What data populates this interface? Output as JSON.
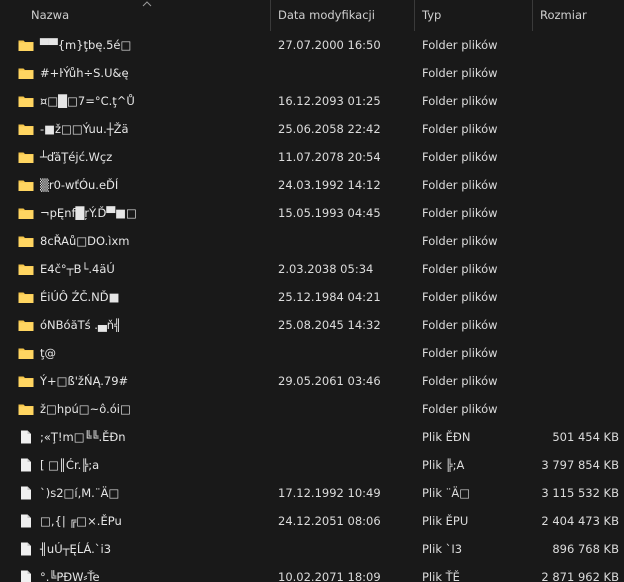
{
  "header": {
    "name": "Nazwa",
    "date": "Data modyfikacji",
    "type": "Typ",
    "size": "Rozmiar"
  },
  "colors": {
    "background": "#191919",
    "folder": "#f4c54a",
    "file": "#f0f0f0"
  },
  "rows": [
    {
      "icon": "folder-icon",
      "name": "▀▀{m}ţbę.5é□",
      "date": "27.07.2000 16:50",
      "type": "Folder plików",
      "size": ""
    },
    {
      "icon": "folder-icon",
      "name": "#+ŀÝůh÷S.U&ę",
      "date": "",
      "type": "Folder plików",
      "size": ""
    },
    {
      "icon": "folder-icon",
      "name": "¤□█□7=°C.ţ^Ů",
      "date": "16.12.2093 01:25",
      "type": "Folder plików",
      "size": ""
    },
    {
      "icon": "folder-icon",
      "name": "-■ž□□Ýuu.┼Žä",
      "date": "25.06.2058 22:42",
      "type": "Folder plików",
      "size": ""
    },
    {
      "icon": "folder-icon",
      "name": "┴ďăŢéjć.Wçz",
      "date": "11.07.2078 20:54",
      "type": "Folder plików",
      "size": ""
    },
    {
      "icon": "folder-icon",
      "name": "▒r0-wťÓu.eĎÍ",
      "date": "24.03.1992 14:12",
      "type": "Folder plików",
      "size": ""
    },
    {
      "icon": "folder-icon",
      "name": "¬pĘnf█ŗÝ.Ď▀■□",
      "date": "15.05.1993 04:45",
      "type": "Folder plików",
      "size": ""
    },
    {
      "icon": "folder-icon",
      "name": "8cŘAů□DO.ìxm",
      "date": "",
      "type": "Folder plików",
      "size": ""
    },
    {
      "icon": "folder-icon",
      "name": "E4č°┬B└.4äÚ",
      "date": "2.03.2038 05:34",
      "type": "Folder plików",
      "size": ""
    },
    {
      "icon": "folder-icon",
      "name": "ÉiÚÔ ŹČ.NĎ■",
      "date": "25.12.1984 04:21",
      "type": "Folder plików",
      "size": ""
    },
    {
      "icon": "folder-icon",
      "name": "óNBóăTś .▄ň╣",
      "date": "25.08.2045 14:32",
      "type": "Folder plików",
      "size": ""
    },
    {
      "icon": "folder-icon",
      "name": "ţ@",
      "date": "",
      "type": "Folder plików",
      "size": ""
    },
    {
      "icon": "folder-icon",
      "name": "Ý+□ß'žŃĄ.79#",
      "date": "29.05.2061 03:46",
      "type": "Folder plików",
      "size": ""
    },
    {
      "icon": "folder-icon",
      "name": "ž□hpú□~ô.ói□",
      "date": "",
      "type": "Folder plików",
      "size": ""
    },
    {
      "icon": "file-icon",
      "name": ";«Ţ!m□╚╚.ĚĐn",
      "date": "",
      "type": "Plik ĚĐN",
      "size": "501 454 KB"
    },
    {
      "icon": "file-icon",
      "name": "[ □║Ćr.╠;a",
      "date": "",
      "type": "Plik ╠;A",
      "size": "3 797 854 KB"
    },
    {
      "icon": "file-icon",
      "name": "`)s2□í,M.¨Ä□",
      "date": "17.12.1992 10:49",
      "type": "Plik ¨Ä□",
      "size": "3 115 532 KB"
    },
    {
      "icon": "file-icon",
      "name": "□,{| ╔□×.ĚPu",
      "date": "24.12.2051 08:06",
      "type": "Plik ĚPU",
      "size": "2 404 473 KB"
    },
    {
      "icon": "file-icon",
      "name": "╢uÚ┬ĘĹÁ.`i3",
      "date": "",
      "type": "Plik `I3",
      "size": "896 768 KB"
    },
    {
      "icon": "file-icon",
      "name": "°.╚PÐW⸗Ťe",
      "date": "10.02.2071 18:09",
      "type": "Plik ŤĚ",
      "size": "2 871 962 KB"
    }
  ]
}
